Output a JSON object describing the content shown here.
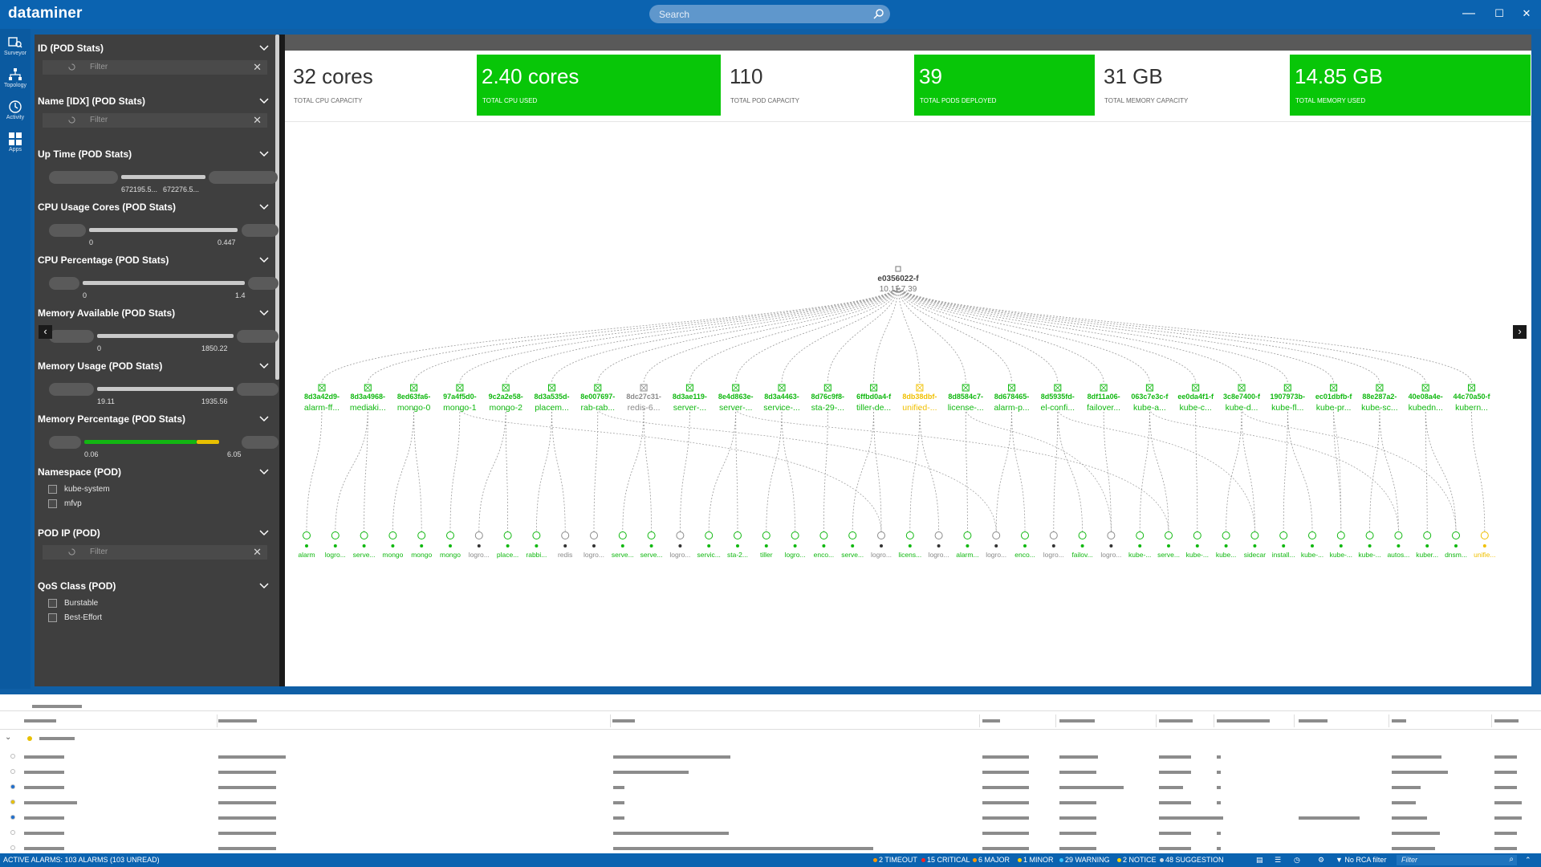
{
  "app": {
    "title": "dataminer"
  },
  "search": {
    "placeholder": "Search"
  },
  "window_controls": {
    "minimize": "—",
    "maximize": "☐",
    "close": "✕"
  },
  "nav": [
    {
      "id": "surveyor",
      "label": "Surveyor",
      "icon": "surveyor-icon"
    },
    {
      "id": "topology",
      "label": "Topology",
      "icon": "topology-icon"
    },
    {
      "id": "activity",
      "label": "Activity",
      "icon": "activity-icon"
    },
    {
      "id": "apps",
      "label": "Apps",
      "icon": "apps-icon"
    }
  ],
  "filters": {
    "id": {
      "title": "ID (POD Stats)",
      "placeholder": "Filter"
    },
    "name": {
      "title": "Name [IDX] (POD Stats)",
      "placeholder": "Filter"
    },
    "uptime": {
      "title": "Up Time (POD Stats)",
      "min": "672195.5...",
      "max": "672276.5..."
    },
    "cpu_cores": {
      "title": "CPU Usage Cores (POD Stats)",
      "min": "0",
      "max": "0.447"
    },
    "cpu_pct": {
      "title": "CPU Percentage (POD Stats)",
      "min": "0",
      "max": "1.4"
    },
    "mem_avail": {
      "title": "Memory Available (POD Stats)",
      "min": "0",
      "max": "1850.22"
    },
    "mem_usage": {
      "title": "Memory Usage (POD Stats)",
      "min": "19.11",
      "max": "1935.56"
    },
    "mem_pct": {
      "title": "Memory Percentage (POD Stats)",
      "min": "0.06",
      "max": "6.05"
    },
    "namespace": {
      "title": "Namespace (POD)",
      "options": [
        "kube-system",
        "mfvp"
      ]
    },
    "pod_ip": {
      "title": "POD IP (POD)",
      "placeholder": "Filter"
    },
    "qos": {
      "title": "QoS Class (POD)",
      "options": [
        "Burstable",
        "Best-Effort"
      ]
    }
  },
  "kpis": [
    {
      "value": "32 cores",
      "label": "TOTAL CPU CAPACITY",
      "highlight": false
    },
    {
      "value": "2.40 cores",
      "label": "TOTAL CPU USED",
      "highlight": true
    },
    {
      "value": "110",
      "label": "TOTAL POD CAPACITY",
      "highlight": false
    },
    {
      "value": "39",
      "label": "TOTAL PODS DEPLOYED",
      "highlight": true
    },
    {
      "value": "31 GB",
      "label": "TOTAL MEMORY CAPACITY",
      "highlight": false
    },
    {
      "value": "14.85 GB",
      "label": "TOTAL MEMORY USED",
      "highlight": true
    }
  ],
  "topology": {
    "root": {
      "id": "e0356022-f",
      "ip": "10.11.7.39"
    },
    "pods": [
      {
        "id": "8d3a42d9-",
        "name": "alarm-ff...",
        "status": "green"
      },
      {
        "id": "8d3a4968-",
        "name": "mediaki...",
        "status": "green"
      },
      {
        "id": "8ed63fa6-",
        "name": "mongo-0",
        "status": "green"
      },
      {
        "id": "97a4f5d0-",
        "name": "mongo-1",
        "status": "green"
      },
      {
        "id": "9c2a2e58-",
        "name": "mongo-2",
        "status": "green"
      },
      {
        "id": "8d3a535d-",
        "name": "placem...",
        "status": "green"
      },
      {
        "id": "8e007697-",
        "name": "rab-rab...",
        "status": "green"
      },
      {
        "id": "8dc27c31-",
        "name": "redis-6...",
        "status": "grey"
      },
      {
        "id": "8d3ae119-",
        "name": "server-...",
        "status": "green"
      },
      {
        "id": "8e4d863e-",
        "name": "server-...",
        "status": "green"
      },
      {
        "id": "8d3a4463-",
        "name": "service-...",
        "status": "green"
      },
      {
        "id": "8d76c9f8-",
        "name": "sta-29-...",
        "status": "green"
      },
      {
        "id": "6ffbd0a4-f",
        "name": "tiller-de...",
        "status": "green"
      },
      {
        "id": "8db38dbf-",
        "name": "unified-...",
        "status": "yellow"
      },
      {
        "id": "8d8584c7-",
        "name": "license-...",
        "status": "green"
      },
      {
        "id": "8d678465-",
        "name": "alarm-p...",
        "status": "green"
      },
      {
        "id": "8d5935fd-",
        "name": "el-confi...",
        "status": "green"
      },
      {
        "id": "8df11a06-",
        "name": "failover...",
        "status": "green"
      },
      {
        "id": "063c7e3c-f",
        "name": "kube-a...",
        "status": "green"
      },
      {
        "id": "ee0da4f1-f",
        "name": "kube-c...",
        "status": "green"
      },
      {
        "id": "3c8e7400-f",
        "name": "kube-d...",
        "status": "green"
      },
      {
        "id": "1907973b-",
        "name": "kube-fl...",
        "status": "green"
      },
      {
        "id": "ec01dbfb-f",
        "name": "kube-pr...",
        "status": "green"
      },
      {
        "id": "88e287a2-",
        "name": "kube-sc...",
        "status": "green"
      },
      {
        "id": "40e08a4e-",
        "name": "kubedn...",
        "status": "green"
      },
      {
        "id": "44c70a50-f",
        "name": "kubern...",
        "status": "green"
      }
    ],
    "containers": [
      {
        "name": "alarm",
        "status": "green"
      },
      {
        "name": "logro...",
        "status": "green"
      },
      {
        "name": "serve...",
        "status": "green"
      },
      {
        "name": "mongo",
        "status": "green"
      },
      {
        "name": "mongo",
        "status": "green"
      },
      {
        "name": "mongo",
        "status": "green"
      },
      {
        "name": "logro...",
        "status": "grey"
      },
      {
        "name": "place...",
        "status": "green"
      },
      {
        "name": "rabbi...",
        "status": "green"
      },
      {
        "name": "redis",
        "status": "grey"
      },
      {
        "name": "logro...",
        "status": "grey"
      },
      {
        "name": "serve...",
        "status": "green"
      },
      {
        "name": "serve...",
        "status": "green"
      },
      {
        "name": "logro...",
        "status": "grey"
      },
      {
        "name": "servic...",
        "status": "green"
      },
      {
        "name": "sta-2...",
        "status": "green"
      },
      {
        "name": "tiller",
        "status": "green"
      },
      {
        "name": "logro...",
        "status": "green"
      },
      {
        "name": "enco...",
        "status": "green"
      },
      {
        "name": "serve...",
        "status": "green"
      },
      {
        "name": "logro...",
        "status": "grey"
      },
      {
        "name": "licens...",
        "status": "green"
      },
      {
        "name": "logro...",
        "status": "grey"
      },
      {
        "name": "alarm...",
        "status": "green"
      },
      {
        "name": "logro...",
        "status": "grey"
      },
      {
        "name": "enco...",
        "status": "green"
      },
      {
        "name": "logro...",
        "status": "grey"
      },
      {
        "name": "failov...",
        "status": "green"
      },
      {
        "name": "logro...",
        "status": "grey"
      },
      {
        "name": "kube-...",
        "status": "green"
      },
      {
        "name": "serve...",
        "status": "green"
      },
      {
        "name": "kube-...",
        "status": "green"
      },
      {
        "name": "kube...",
        "status": "green"
      },
      {
        "name": "sidecar",
        "status": "green"
      },
      {
        "name": "install...",
        "status": "green"
      },
      {
        "name": "kube-...",
        "status": "green"
      },
      {
        "name": "kube-...",
        "status": "green"
      },
      {
        "name": "kube-...",
        "status": "green"
      },
      {
        "name": "autos...",
        "status": "green"
      },
      {
        "name": "kuber...",
        "status": "green"
      },
      {
        "name": "dnsm...",
        "status": "green"
      },
      {
        "name": "unifie...",
        "status": "yellow"
      }
    ]
  },
  "status_bar": {
    "active_alarms": "ACTIVE ALARMS: 103 ALARMS (103 UNREAD)",
    "severities": [
      {
        "label": "2 TIMEOUT",
        "color": "#ff9900"
      },
      {
        "label": "15 CRITICAL",
        "color": "#ff2020"
      },
      {
        "label": "6 MAJOR",
        "color": "#ff9900"
      },
      {
        "label": "1 MINOR",
        "color": "#ffcc00"
      },
      {
        "label": "29 WARNING",
        "color": "#35c4ff"
      },
      {
        "label": "2 NOTICE",
        "color": "#ffd000"
      },
      {
        "label": "48 SUGGESTION",
        "color": "#cfd8e0"
      }
    ],
    "rca_filter": "No RCA filter",
    "filter_placeholder": "Filter"
  },
  "colors": {
    "green": "#10b810",
    "grey": "#8a8a8a",
    "yellow": "#f0c000",
    "kpi_green": "#08c608",
    "brand_blue": "#0b63b0"
  }
}
